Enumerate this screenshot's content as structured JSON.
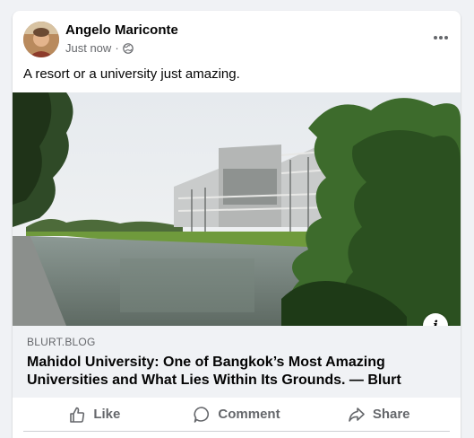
{
  "post": {
    "author": "Angelo Mariconte",
    "timestamp": "Just now",
    "separator": "·",
    "privacy_icon": "globe-icon",
    "text": "A resort or a university just amazing."
  },
  "link_preview": {
    "domain": "BLURT.BLOG",
    "title": "Mahidol University: One of Bangkok’s Most Amazing Universities and What Lies Within Its Grounds. — Blurt"
  },
  "actions": {
    "like": "Like",
    "comment": "Comment",
    "share": "Share"
  },
  "colors": {
    "background": "#f0f2f5",
    "card": "#ffffff",
    "secondary_text": "#65676b"
  }
}
